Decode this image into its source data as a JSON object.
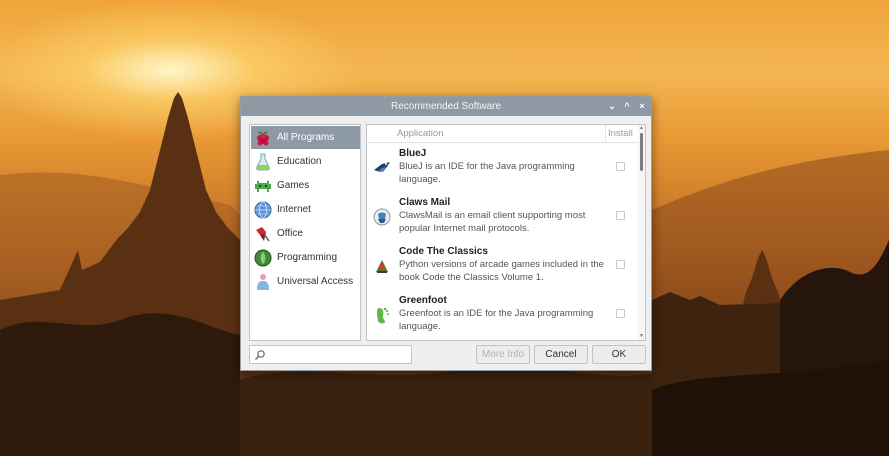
{
  "window": {
    "title": "Recommended Software",
    "controls": {
      "minimize": "⌄",
      "maximize": "^",
      "close": "×"
    }
  },
  "sidebar": {
    "items": [
      {
        "label": "All Programs",
        "icon": "raspberry-icon",
        "selected": true
      },
      {
        "label": "Education",
        "icon": "education-icon",
        "selected": false
      },
      {
        "label": "Games",
        "icon": "games-icon",
        "selected": false
      },
      {
        "label": "Internet",
        "icon": "internet-icon",
        "selected": false
      },
      {
        "label": "Office",
        "icon": "office-icon",
        "selected": false
      },
      {
        "label": "Programming",
        "icon": "programming-icon",
        "selected": false
      },
      {
        "label": "Universal Access",
        "icon": "universal-access-icon",
        "selected": false
      }
    ]
  },
  "list": {
    "columns": {
      "application": "Application",
      "install": "Install"
    },
    "rows": [
      {
        "name": "BlueJ",
        "description": "BlueJ is an IDE for the Java programming language.",
        "icon": "bluej-icon",
        "install": false
      },
      {
        "name": "Claws Mail",
        "description": "ClawsMail is an email client supporting most popular Internet mail protocols.",
        "icon": "claws-mail-icon",
        "install": false
      },
      {
        "name": "Code The Classics",
        "description": "Python versions of arcade games included in the book Code the Classics Volume 1.",
        "icon": "code-the-classics-icon",
        "install": false
      },
      {
        "name": "Greenfoot",
        "description": "Greenfoot is an IDE for the Java programming language.",
        "icon": "greenfoot-icon",
        "install": false
      }
    ]
  },
  "search": {
    "value": "",
    "placeholder": ""
  },
  "buttons": {
    "more_info": "More Info",
    "cancel": "Cancel",
    "ok": "OK"
  },
  "colors": {
    "titlebar": "#8d9aa6",
    "selection": "#8d9aa6",
    "dialog_bg": "#efefef"
  }
}
